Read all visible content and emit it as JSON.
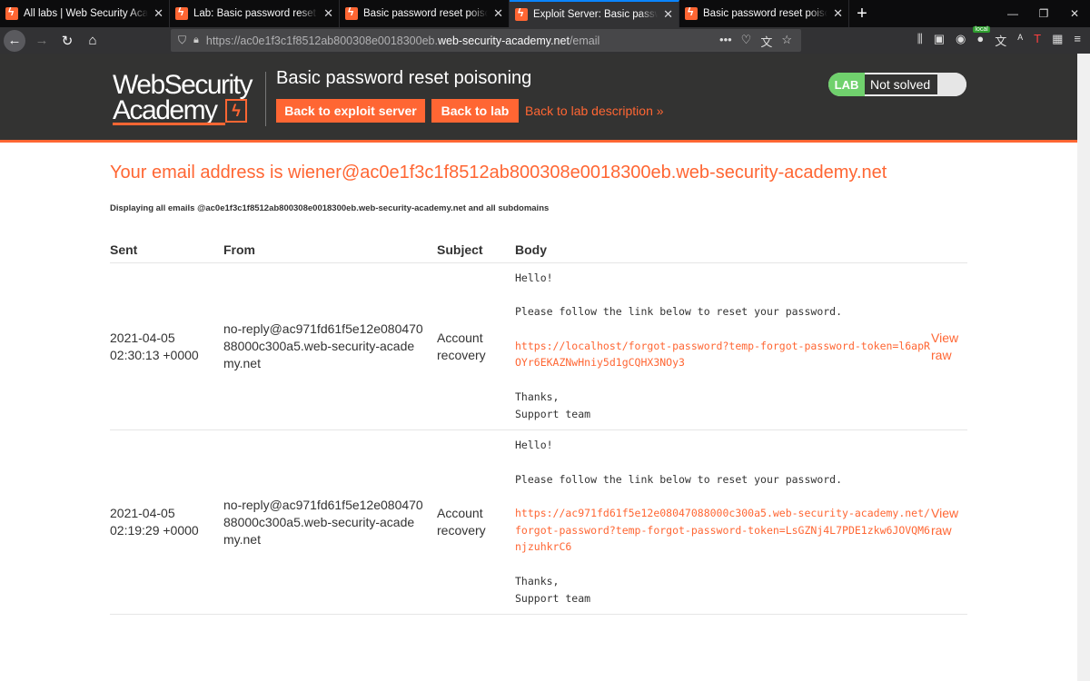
{
  "browser": {
    "tabs": [
      {
        "title": "All labs | Web Security Academy",
        "active": false
      },
      {
        "title": "Lab: Basic password reset poisoning",
        "active": false
      },
      {
        "title": "Basic password reset poisoning",
        "active": false
      },
      {
        "title": "Exploit Server: Basic password reset poisoning",
        "active": true
      },
      {
        "title": "Basic password reset poisoning",
        "active": false
      }
    ],
    "url_prefix": "https://ac0e1f3c1f8512ab800308e0018300eb.",
    "url_host": "web-security-academy.net",
    "url_path": "/email",
    "local_badge": "local"
  },
  "header": {
    "logo_line1": "WebSecurity",
    "logo_line2": "Academy",
    "lab_title": "Basic password reset poisoning",
    "back_exploit_label": "Back to exploit server",
    "back_lab_label": "Back to lab",
    "desc_link_label": "Back to lab description »",
    "status_lab": "LAB",
    "status_text": "Not solved"
  },
  "main": {
    "email_heading": "Your email address is wiener@ac0e1f3c1f8512ab800308e0018300eb.web-security-academy.net",
    "email_sub": "Displaying all emails @ac0e1f3c1f8512ab800308e0018300eb.web-security-academy.net and all subdomains",
    "columns": [
      "Sent",
      "From",
      "Subject",
      "Body"
    ],
    "emails": [
      {
        "sent_date": "2021-04-05",
        "sent_time": "02:30:13 +0000",
        "from": "no-reply@ac971fd61f5e12e08047088000c300a5.web-security-academy.net",
        "subject": "Account recovery",
        "greeting": "Hello!",
        "instruction": "Please follow the link below to reset your password.",
        "link": "https://localhost/forgot-password?temp-forgot-password-token=l6apROYr6EKAZNwHniy5d1gCQHX3NOy3",
        "closing": "Thanks,",
        "signature": "Support team",
        "view_raw": "View raw"
      },
      {
        "sent_date": "2021-04-05",
        "sent_time": "02:19:29 +0000",
        "from": "no-reply@ac971fd61f5e12e08047088000c300a5.web-security-academy.net",
        "subject": "Account recovery",
        "greeting": "Hello!",
        "instruction": "Please follow the link below to reset your password.",
        "link": "https://ac971fd61f5e12e08047088000c300a5.web-security-academy.net/forgot-password?temp-forgot-password-token=LsGZNj4L7PDE1zkw6JOVQM6njzuhkrC6",
        "closing": "Thanks,",
        "signature": "Support team",
        "view_raw": "View raw"
      }
    ]
  }
}
